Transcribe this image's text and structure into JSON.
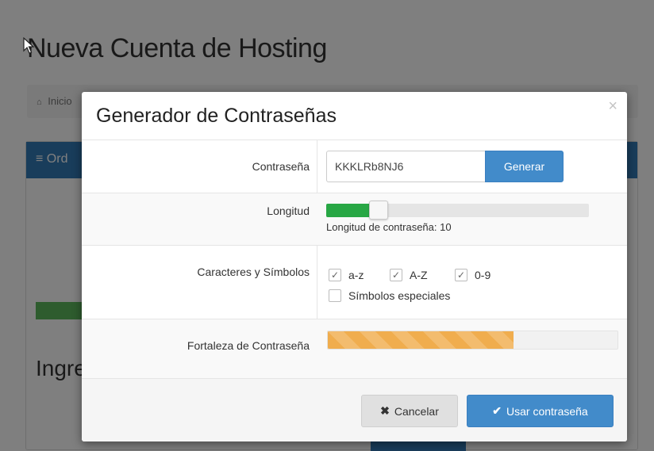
{
  "page": {
    "title": "Nueva Cuenta de Hosting",
    "breadcrumb_home": "Inicio",
    "panel_heading": "Ord",
    "section_title": "Ingre"
  },
  "modal": {
    "title": "Generador de Contraseñas",
    "close_glyph": "×",
    "password": {
      "label": "Contraseña",
      "value": "KKKLRb8NJ6",
      "generate_label": "Generar"
    },
    "length": {
      "label": "Longitud",
      "caption": "Longitud de contraseña: 10",
      "value": 10,
      "fraction": 0.2
    },
    "characters": {
      "label": "Caracteres y Símbolos",
      "options": [
        {
          "label": "a-z",
          "checked": true
        },
        {
          "label": "A-Z",
          "checked": true
        },
        {
          "label": "0-9",
          "checked": true
        },
        {
          "label": "Símbolos especiales",
          "checked": false
        }
      ]
    },
    "strength": {
      "label": "Fortaleza de Contraseña",
      "fraction": 0.64,
      "color": "#f0ad4e"
    },
    "footer": {
      "cancel_label": "Cancelar",
      "cancel_icon": "times-icon",
      "use_label": "Usar contraseña",
      "use_icon": "check-icon"
    }
  },
  "colors": {
    "primary": "#428bca",
    "success": "#28a745",
    "warning": "#f0ad4e"
  }
}
